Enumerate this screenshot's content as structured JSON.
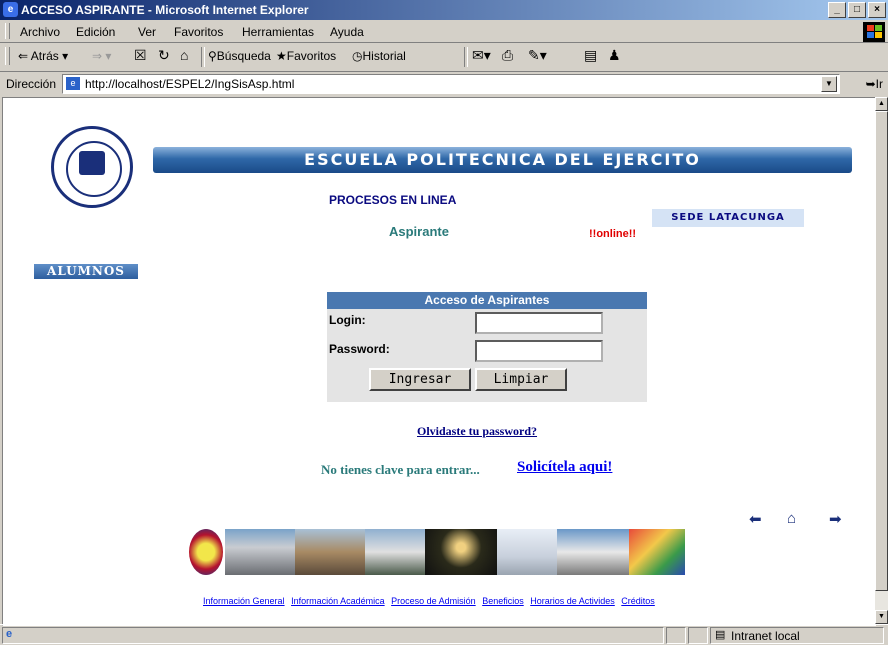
{
  "window": {
    "title": "ACCESO ASPIRANTE - Microsoft Internet Explorer",
    "buttons": [
      "_",
      "&#8471;",
      "x"
    ]
  },
  "menubar": {
    "items": [
      "Archivo",
      "Edición",
      "Ver",
      "Favoritos",
      "Herramientas",
      "Ayuda"
    ]
  },
  "toolbar": {
    "back_label": "Atrás",
    "search_label": "Búsqueda",
    "favorites_label": "Favoritos",
    "history_label": "Historial"
  },
  "address": {
    "label": "Dirección",
    "url": "http://localhost/ESPEL2/IngSisAsp.html",
    "go_label": "Ir"
  },
  "page": {
    "banner": "ESCUELA POLITECNICA DEL EJERCITO",
    "procesos": "PROCESOS EN LINEA",
    "aspirante": "Aspirante",
    "online": "!!online!!",
    "sede": "SEDE LATACUNGA",
    "alumnos": "ALUMNOS",
    "login_box": {
      "title": "Acceso de Aspirantes",
      "login_label": "Login:",
      "login_value": "",
      "password_label": "Password:",
      "password_value": "",
      "submit_label": "Ingresar",
      "clear_label": "Limpiar"
    },
    "forgot": "Olvidaste tu password?",
    "no_key": "No tienes clave para entrar...",
    "request_link": "Solicítela aqui!",
    "footer_links": [
      "Información General",
      "Información Académica",
      "Proceso de Admisión",
      "Beneficios",
      "Horarios de Activides",
      "Créditos"
    ]
  },
  "statusbar": {
    "zone": "Intranet local"
  }
}
